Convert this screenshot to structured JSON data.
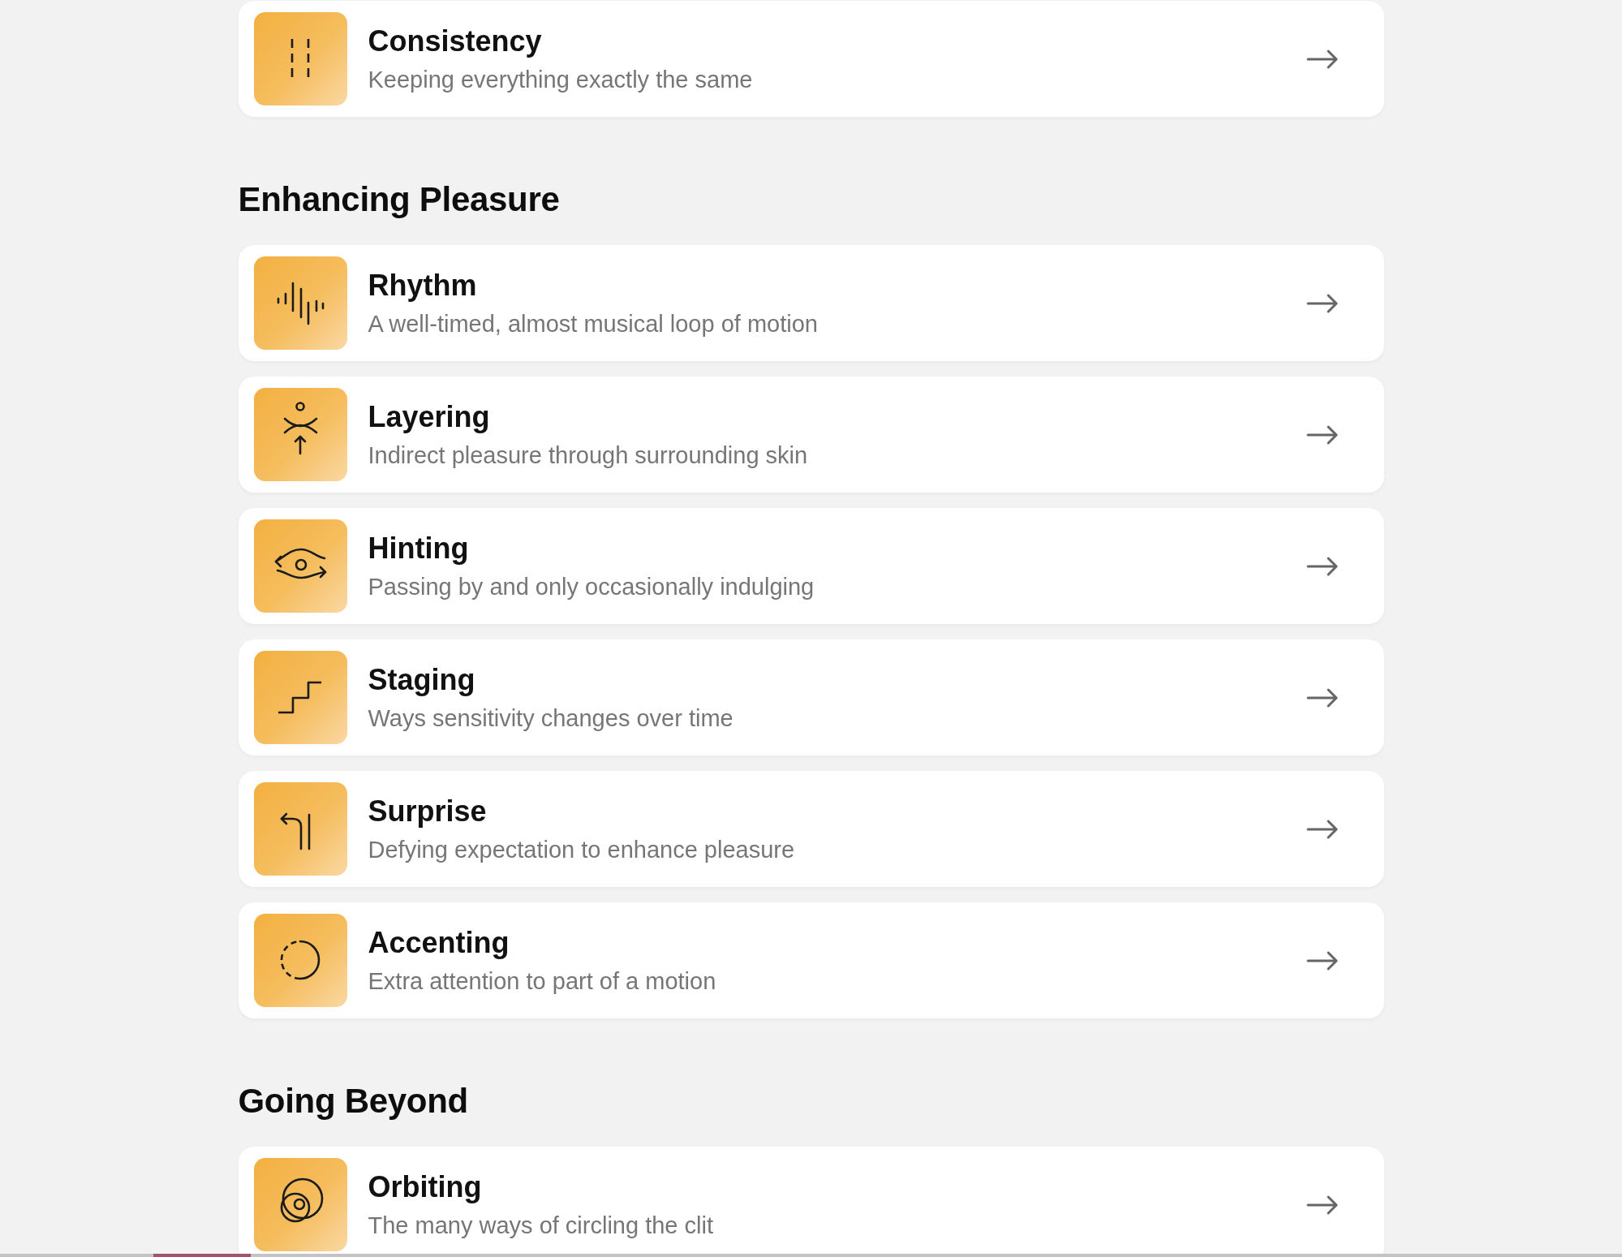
{
  "sections": [
    {
      "items": [
        {
          "title": "Consistency",
          "subtitle": "Keeping everything exactly the same"
        }
      ]
    },
    {
      "heading": "Enhancing Pleasure",
      "items": [
        {
          "title": "Rhythm",
          "subtitle": "A well-timed, almost musical loop of motion"
        },
        {
          "title": "Layering",
          "subtitle": "Indirect pleasure through surrounding skin"
        },
        {
          "title": "Hinting",
          "subtitle": "Passing by and only occasionally indulging"
        },
        {
          "title": "Staging",
          "subtitle": "Ways sensitivity changes over time"
        },
        {
          "title": "Surprise",
          "subtitle": "Defying expectation to enhance pleasure"
        },
        {
          "title": "Accenting",
          "subtitle": "Extra attention to part of a motion"
        }
      ]
    },
    {
      "heading": "Going Beyond",
      "items": [
        {
          "title": "Orbiting",
          "subtitle": "The many ways of circling the clit"
        }
      ]
    }
  ]
}
